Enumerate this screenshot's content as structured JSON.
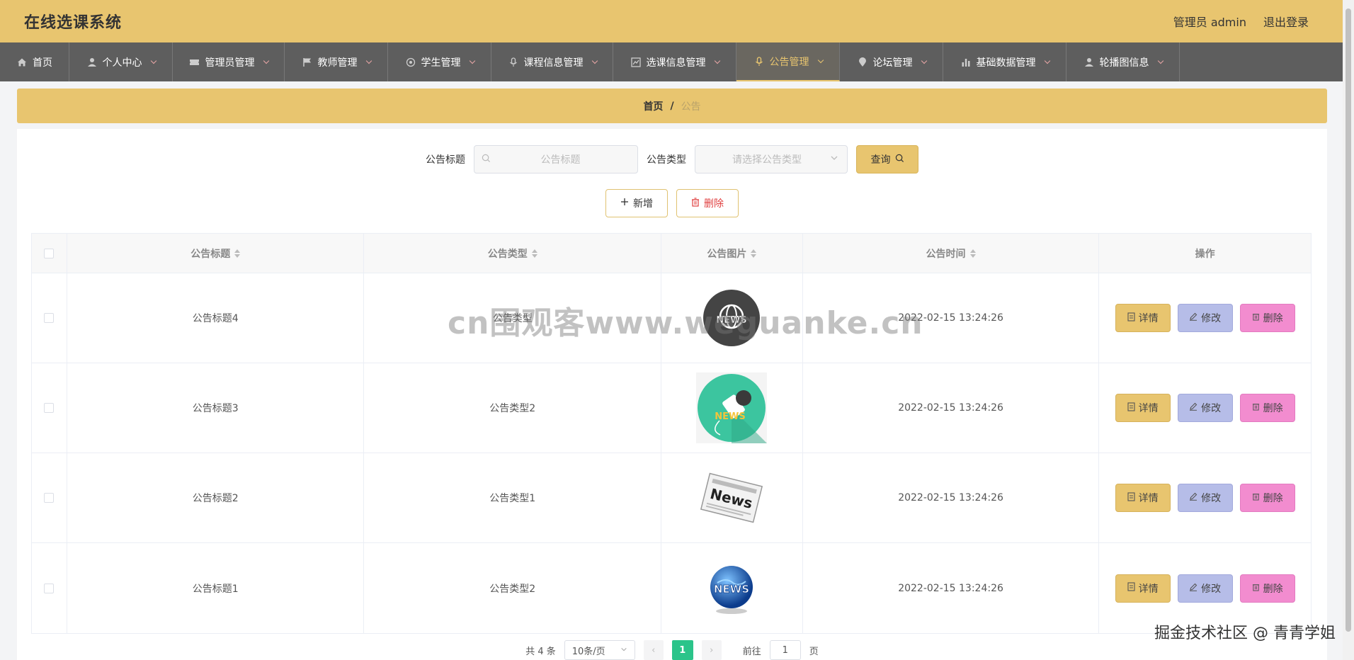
{
  "header": {
    "title": "在线选课系统",
    "user": "管理员 admin",
    "logout": "退出登录"
  },
  "nav": [
    {
      "label": "首页",
      "icon": "home-icon",
      "chev": false,
      "active": false
    },
    {
      "label": "个人中心",
      "icon": "user-icon",
      "chev": true,
      "active": false
    },
    {
      "label": "管理员管理",
      "icon": "ticket-icon",
      "chev": true,
      "active": false
    },
    {
      "label": "教师管理",
      "icon": "flag-icon",
      "chev": true,
      "active": false
    },
    {
      "label": "学生管理",
      "icon": "aperture-icon",
      "chev": true,
      "active": false
    },
    {
      "label": "课程信息管理",
      "icon": "mic-icon",
      "chev": true,
      "active": false
    },
    {
      "label": "选课信息管理",
      "icon": "chart-icon",
      "chev": true,
      "active": false
    },
    {
      "label": "公告管理",
      "icon": "mic-icon",
      "chev": true,
      "active": true
    },
    {
      "label": "论坛管理",
      "icon": "pin-icon",
      "chev": true,
      "active": false
    },
    {
      "label": "基础数据管理",
      "icon": "bar-chart-icon",
      "chev": true,
      "active": false
    },
    {
      "label": "轮播图信息",
      "icon": "user-icon",
      "chev": true,
      "active": false
    }
  ],
  "breadcrumb": {
    "home": "首页",
    "sep": "/",
    "current": "公告"
  },
  "search": {
    "title_label": "公告标题",
    "title_placeholder": "公告标题",
    "type_label": "公告类型",
    "type_placeholder": "请选择公告类型",
    "query_label": "查询"
  },
  "actions": {
    "add": "新增",
    "delete": "删除"
  },
  "table": {
    "headers": [
      "公告标题",
      "公告类型",
      "公告图片",
      "公告时间",
      "操作"
    ],
    "rows": [
      {
        "title": "公告标题4",
        "type": "公告类型",
        "image": "globe-news-icon",
        "time": "2022-02-15 13:24:26"
      },
      {
        "title": "公告标题3",
        "type": "公告类型2",
        "image": "mic-news-icon",
        "time": "2022-02-15 13:24:26"
      },
      {
        "title": "公告标题2",
        "type": "公告类型1",
        "image": "newspaper-icon",
        "time": "2022-02-15 13:24:26"
      },
      {
        "title": "公告标题1",
        "type": "公告类型2",
        "image": "globe-3d-news-icon",
        "time": "2022-02-15 13:24:26"
      }
    ],
    "ops": {
      "detail": "详情",
      "edit": "修改",
      "delete": "删除"
    }
  },
  "pager": {
    "total": "共 4 条",
    "size": "10条/页",
    "current": "1",
    "goto": "前往",
    "goto_value": "1",
    "page": "页"
  },
  "watermark": "cn围观客www.weguanke.cn",
  "footer_mark": "掘金技术社区 @ 青青学姐",
  "colors": {
    "header": "#e8c56f",
    "nav": "#5e5e5e",
    "page_active": "#2bc48a",
    "edit": "#b6bde8",
    "delete": "#f28ccf"
  }
}
